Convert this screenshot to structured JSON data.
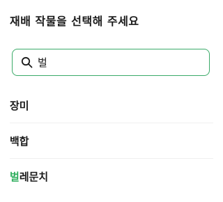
{
  "header": {
    "title": "재배 작물을 선택해 주세요"
  },
  "search": {
    "value": "벌",
    "placeholder": "",
    "accent_color": "#3aaa68"
  },
  "results": [
    {
      "prefix": "",
      "match": "",
      "rest": "장미"
    },
    {
      "prefix": "",
      "match": "",
      "rest": "백합"
    },
    {
      "prefix": "",
      "match": "벌",
      "rest": "레문치"
    }
  ],
  "colors": {
    "highlight": "#2fae5e",
    "text": "#1a1a1a"
  },
  "icons": {
    "search": "search-icon"
  }
}
